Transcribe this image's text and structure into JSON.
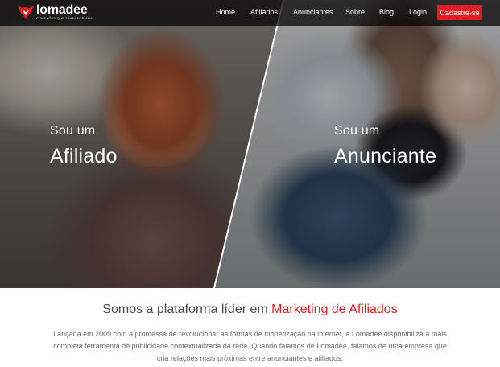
{
  "brand": {
    "name": "lomadee",
    "tagline": "CONEXÕES QUE TRANSFORMAM",
    "accent_color": "#e31b23"
  },
  "nav": {
    "items": [
      {
        "label": "Home"
      },
      {
        "label": "Afiliados"
      },
      {
        "label": "Anunciantes"
      },
      {
        "label": "Sobre"
      },
      {
        "label": "Blog"
      },
      {
        "label": "Login"
      }
    ],
    "cta_label": "Cadastre-se"
  },
  "hero": {
    "left": {
      "small": "Sou um",
      "big": "Afiliado"
    },
    "right": {
      "small": "Sou um",
      "big": "Anunciante"
    }
  },
  "content": {
    "headline_prefix": "Somos a plataforma líder em ",
    "headline_accent": "Marketing de Afiliados",
    "description": "Lançada em 2009 com a promessa de revolucionar as formas de monetização na internet, a Lomadee disponibiliza a mais completa ferramenta de publicidade contextualizada da rede. Quando falamos de Lomadee, falamos de uma empresa que cria relações mais próximas entre anunciantes e afiliados."
  }
}
